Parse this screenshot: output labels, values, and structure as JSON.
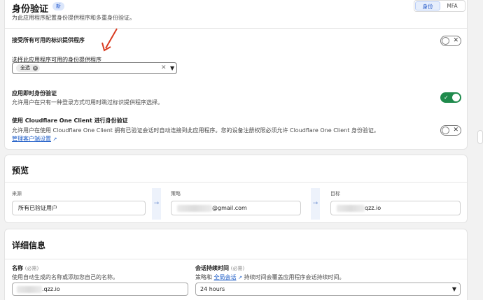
{
  "auth": {
    "title": "身份验证",
    "badge": "新",
    "subtitle": "为此应用程序配置身份提供程序和多重身份验证。",
    "tabs": [
      "身份",
      "MFA"
    ],
    "accept_all_label": "接受所有可用的标识提供程序",
    "select_idp_label": "选择此应用程序可用的身份提供程序",
    "select_chip": "全选",
    "instant_label": "应用即时身份验证",
    "instant_help": "允许用户在只有一种登录方式可用时跳过标识提供程序选择。",
    "warp_label": "使用 Cloudflare One Client 进行身份验证",
    "warp_help": "允许用户在使用 Cloudflare One Client 拥有已验证会话时自动连接到此应用程序。您的设备注册权限必须允许 Cloudflare One Client 身份验证。",
    "manage_link": "管理客户端设置",
    "toggles": {
      "accept_all": false,
      "instant": true,
      "warp": false
    }
  },
  "preview": {
    "title": "预览",
    "source_label": "来源",
    "source_value": "所有已验证用户",
    "policy_label": "策略",
    "policy_value": "@gmail.com",
    "target_label": "目标",
    "target_value": "qzz.io"
  },
  "details": {
    "title": "详细信息",
    "name_label": "名称",
    "name_req": "(必需)",
    "name_help": "使用自动生成的名称或添加您自己的名称。",
    "name_value": ".qzz.io",
    "session_label": "会话持续时间",
    "session_req": "(必需)",
    "session_help_prefix": "策略和",
    "session_help_link": "全局会话",
    "session_help_suffix": "持续时间会覆盖应用程序会话持续时间。",
    "session_value": "24 hours"
  },
  "colors": {
    "accent": "#1d5cc7",
    "toggle_on": "#1f8a4c",
    "annotation_arrow": "#d93a1f"
  }
}
